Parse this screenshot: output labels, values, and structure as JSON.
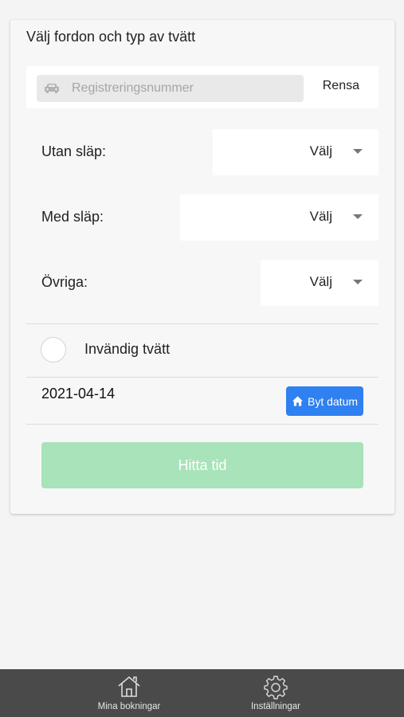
{
  "card": {
    "title": "Välj fordon och typ av tvätt",
    "registration": {
      "placeholder": "Registreringsnummer",
      "clear_label": "Rensa",
      "icon": "car-icon"
    },
    "selects": [
      {
        "label": "Utan släp:",
        "value": "Välj"
      },
      {
        "label": "Med släp:",
        "value": "Välj"
      },
      {
        "label": "Övriga:",
        "value": "Välj"
      }
    ],
    "interior_wash": {
      "label": "Invändig tvätt",
      "checked": false
    },
    "date": "2021-04-14",
    "change_date_label": "Byt datum",
    "change_date_icon": "home-icon",
    "find_time_label": "Hitta tid"
  },
  "tabbar": {
    "items": [
      {
        "label": "Mina bokningar",
        "icon": "home-outline-icon"
      },
      {
        "label": "Inställningar",
        "icon": "gear-icon"
      }
    ]
  },
  "colors": {
    "primary": "#2f80f0",
    "find_button_disabled": "#a8e3b9",
    "tabbar": "#4a4a4a"
  }
}
